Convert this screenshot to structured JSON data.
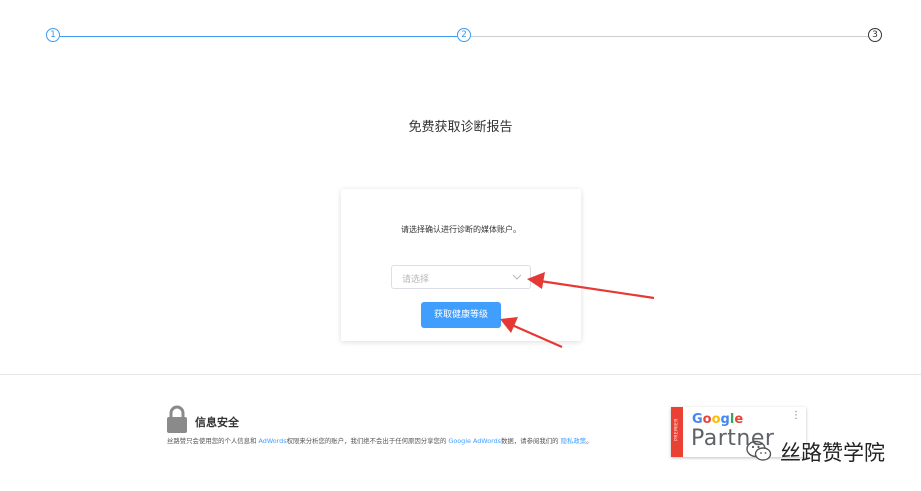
{
  "stepper": {
    "steps": [
      {
        "number": "1",
        "state": "done"
      },
      {
        "number": "2",
        "state": "current"
      },
      {
        "number": "3",
        "state": "pending"
      }
    ],
    "colors": {
      "active": "#3d9bf0",
      "pending": "#333333"
    }
  },
  "page": {
    "title": "免费获取诊断报告"
  },
  "card": {
    "prompt": "请选择确认进行诊断的媒体账户。",
    "select": {
      "placeholder": "请选择",
      "icon": "chevron-down-icon"
    },
    "button_label": "获取健康等级"
  },
  "security": {
    "icon": "lock-icon",
    "title": "信息安全",
    "text_1": "丝路赞只会使用您的个人信息和 ",
    "link_adwords": "AdWords",
    "text_2": "权限来分析您的账户，我们绝不会出于任何原因分享您的 ",
    "link_google_adwords": "Google AdWords",
    "text_3": "数据，请参阅我们的 ",
    "link_privacy": "隐私政策",
    "text_4": "。"
  },
  "partner_badge": {
    "premier_label": "PREMIER",
    "google_label": "Google",
    "partner_label": "Partner"
  },
  "watermark": {
    "icon": "wechat-icon",
    "text": "丝路赞学院"
  },
  "colors": {
    "primary": "#409eff",
    "arrow": "#e53935"
  }
}
